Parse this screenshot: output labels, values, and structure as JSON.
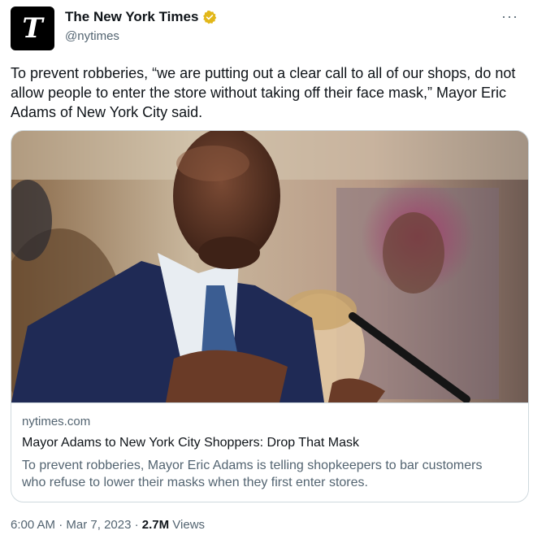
{
  "author": {
    "avatar_glyph": "T",
    "display_name": "The New York Times",
    "handle": "@nytimes",
    "verified_color": "#e2b719"
  },
  "more_label": "···",
  "tweet_text": "To prevent robberies, “we are putting out a clear call to all of our shops, do not allow people to enter the store without taking off their face mask,” Mayor Eric Adams of New York City said.",
  "card": {
    "domain": "nytimes.com",
    "title": "Mayor Adams to New York City Shoppers: Drop That Mask",
    "description": "To prevent robberies, Mayor Eric Adams is telling shopkeepers to bar customers who refuse to lower their masks when they first enter stores."
  },
  "footer": {
    "time": "6:00 AM",
    "sep1": " · ",
    "date": "Mar 7, 2023",
    "sep2": " · ",
    "views_count": "2.7M",
    "views_label": " Views"
  },
  "colors": {
    "text": "#0f1419",
    "secondary": "#536471",
    "border": "#cfd9de"
  }
}
